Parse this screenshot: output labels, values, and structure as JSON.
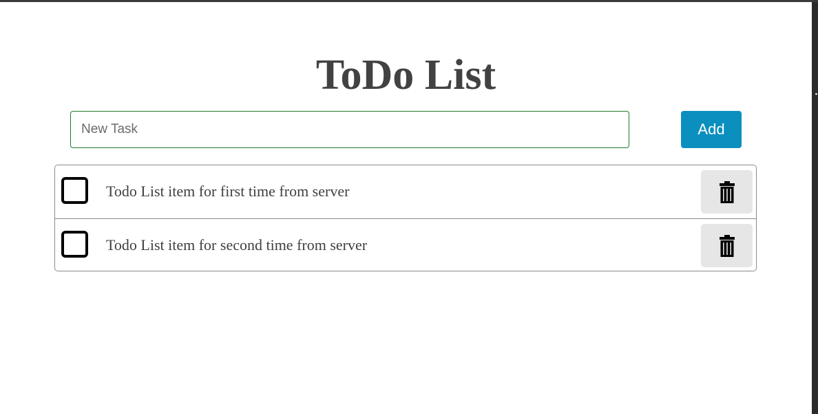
{
  "app": {
    "title": "ToDo List"
  },
  "new_task": {
    "placeholder": "New Task",
    "value": ""
  },
  "add_button": {
    "label": "Add",
    "color": "#0b8fbf"
  },
  "todos": [
    {
      "text": "Todo List item for first time from server",
      "checked": false,
      "delete_icon": "trash-icon"
    },
    {
      "text": "Todo List item for second time from server",
      "checked": false,
      "delete_icon": "trash-icon"
    }
  ],
  "colors": {
    "title": "#424242",
    "input_border": "#1e7a2c",
    "delete_bg": "#e6e6e6"
  }
}
